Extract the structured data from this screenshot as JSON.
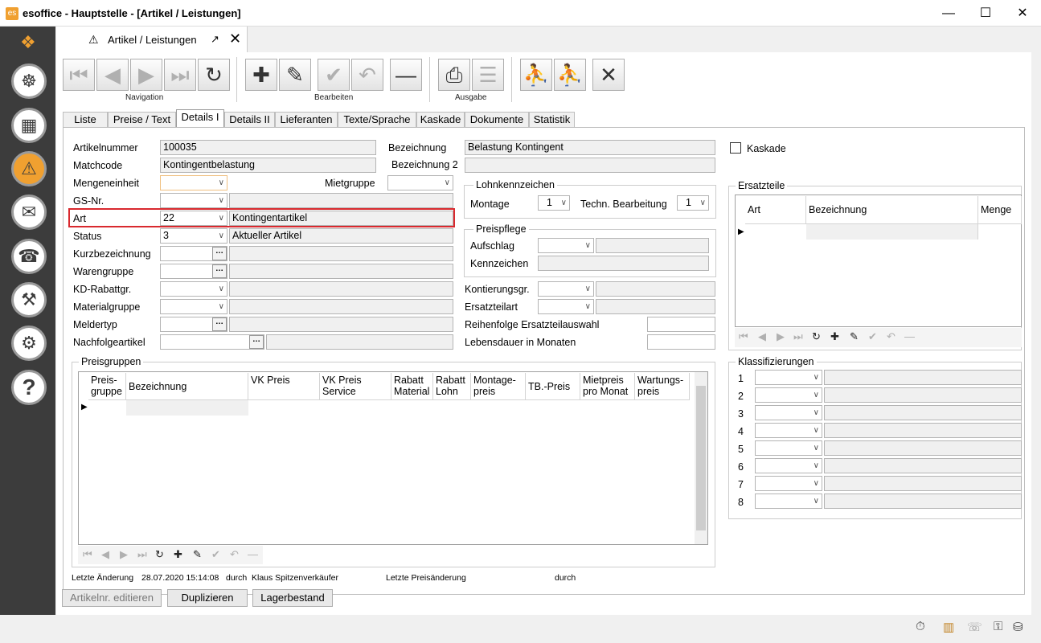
{
  "window": {
    "title": "esoffice - Hauptstelle - [Artikel / Leistungen]",
    "app_icon": "es",
    "min": "—",
    "max": "☐",
    "close": "✕"
  },
  "sidebar": {
    "logo": "❖",
    "items": [
      {
        "name": "helm-icon",
        "glyph": "☸"
      },
      {
        "name": "grid-calendar-icon",
        "glyph": "▦"
      },
      {
        "name": "alarm-light-icon",
        "glyph": "⚠"
      },
      {
        "name": "money-icon",
        "glyph": "✉"
      },
      {
        "name": "headset-icon",
        "glyph": "☎"
      },
      {
        "name": "tools-icon",
        "glyph": "⚒"
      },
      {
        "name": "gears-icon",
        "glyph": "⚙"
      },
      {
        "name": "help-icon",
        "glyph": "?"
      }
    ]
  },
  "doc_tab": {
    "label": "Artikel / Leistungen",
    "icon": "⚠",
    "popout": "↗",
    "close": "✕"
  },
  "toolbar": {
    "groups": [
      "Navigation",
      "Bearbeiten",
      "Ausgabe"
    ],
    "first": "⏮",
    "prev": "◀",
    "next": "▶",
    "last": "⏭",
    "refresh": "↻",
    "add": "✚",
    "edit": "✎",
    "save": "✔",
    "undo": "↶",
    "delete": "—",
    "print": "⎙",
    "export": "☰",
    "walk": "⛹",
    "run": "⛹",
    "close": "✕"
  },
  "tabs": [
    "Liste",
    "Preise / Text",
    "Details I",
    "Details II",
    "Lieferanten",
    "Texte/Sprache",
    "Kaskade",
    "Dokumente",
    "Statistik"
  ],
  "form": {
    "artikelnummer": {
      "label": "Artikelnummer",
      "value": "100035"
    },
    "matchcode": {
      "label": "Matchcode",
      "value": "Kontingentbelastung"
    },
    "mengeneinheit": {
      "label": "Mengeneinheit",
      "value": ""
    },
    "gsnr": {
      "label": "GS-Nr.",
      "value": ""
    },
    "art": {
      "label": "Art",
      "value": "22",
      "text": "Kontingentartikel"
    },
    "status": {
      "label": "Status",
      "value": "3",
      "text": "Aktueller Artikel"
    },
    "kurzbezeichnung": {
      "label": "Kurzbezeichnung"
    },
    "warengruppe": {
      "label": "Warengruppe"
    },
    "kdrabatt": {
      "label": "KD-Rabattgr."
    },
    "materialgruppe": {
      "label": "Materialgruppe"
    },
    "meldertyp": {
      "label": "Meldertyp"
    },
    "nachfolgeartikel": {
      "label": "Nachfolgeartikel"
    },
    "mietgruppe": {
      "label": "Mietgruppe"
    },
    "bezeichnung": {
      "label": "Bezeichnung",
      "value": "Belastung Kontingent"
    },
    "bezeichnung2": {
      "label": "Bezeichnung 2",
      "value": ""
    },
    "kaskade": {
      "label": "Kaskade"
    },
    "lohn": {
      "title": "Lohnkennzeichen",
      "montage_label": "Montage",
      "montage": "1",
      "techn_label": "Techn. Bearbeitung",
      "techn": "1"
    },
    "preispflege": {
      "title": "Preispflege",
      "aufschlag": "Aufschlag",
      "kennzeichen": "Kennzeichen"
    },
    "kontierung": {
      "label": "Kontierungsgr."
    },
    "ersatzteilart": {
      "label": "Ersatzteilart"
    },
    "reihenfolge": {
      "label": "Reihenfolge Ersatzteilauswahl"
    },
    "lebensdauer": {
      "label": "Lebensdauer in Monaten"
    },
    "dots": "…"
  },
  "ersatzteile": {
    "title": "Ersatzteile",
    "columns": [
      "Art",
      "Bezeichnung",
      "Menge"
    ]
  },
  "klassifizierungen": {
    "title": "Klassifizierungen",
    "rows": [
      "1",
      "2",
      "3",
      "4",
      "5",
      "6",
      "7",
      "8"
    ]
  },
  "preisgruppen": {
    "title": "Preisgruppen",
    "columns": [
      "Preis- gruppe",
      "Bezeichnung",
      "VK Preis",
      "VK Preis Service",
      "Rabatt Material",
      "Rabatt Lohn",
      "Montage- preis",
      "TB.-Preis",
      "Mietpreis pro Monat",
      "Wartungs- preis"
    ]
  },
  "mini_nav": [
    "⏮",
    "◀",
    "▶",
    "⏭",
    "↻",
    "✚",
    "✎",
    "✔",
    "↶",
    "—"
  ],
  "footer": {
    "letzte_aenderung_label": "Letzte Änderung",
    "letzte_aenderung": "28.07.2020 15:14:08",
    "durch1": "durch",
    "user": "Klaus Spitzenverkäufer",
    "letzte_preis_label": "Letzte Preisänderung",
    "durch2": "durch"
  },
  "buttons": {
    "edit_nr": "Artikelnr. editieren",
    "duplicate": "Duplizieren",
    "stock": "Lagerbestand"
  },
  "status_icons": {
    "timer": "⏱",
    "building": "▥",
    "phone": "☏",
    "lock": "⚿",
    "db": "⛁"
  },
  "colors": {
    "sidebar": "#3c3c3c",
    "accent": "#f0a030",
    "highlight": "#d9292e"
  }
}
